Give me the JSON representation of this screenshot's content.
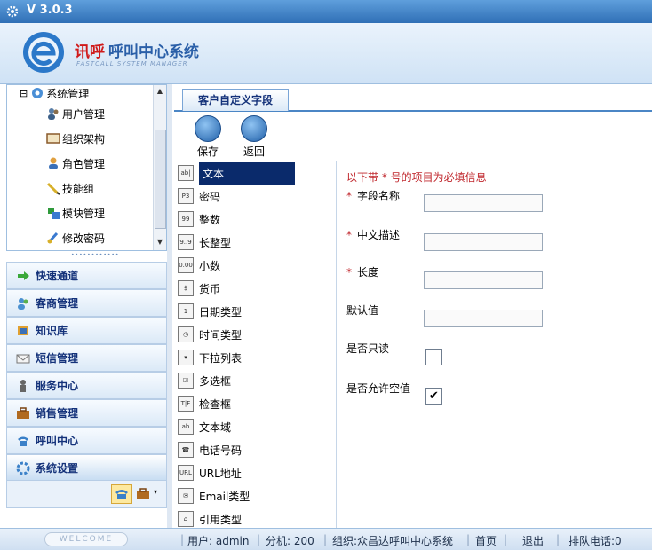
{
  "window": {
    "version": "V 3.0.3"
  },
  "header": {
    "brand": "讯呼",
    "system_name": "呼叫中心系统",
    "subtitle": "FASTCALL SYSTEM MANAGER"
  },
  "tree": {
    "root_label": "系统管理",
    "collapse_symbol": "⊟",
    "items": [
      {
        "label": "用户管理",
        "icon": "users-icon"
      },
      {
        "label": "组织架构",
        "icon": "org-icon"
      },
      {
        "label": "角色管理",
        "icon": "role-icon"
      },
      {
        "label": "技能组",
        "icon": "pencil-icon"
      },
      {
        "label": "模块管理",
        "icon": "module-icon"
      },
      {
        "label": "修改密码",
        "icon": "password-icon"
      }
    ]
  },
  "accordion": [
    {
      "label": "快速通道",
      "icon": "arrow-right-icon"
    },
    {
      "label": "客商管理",
      "icon": "customer-icon"
    },
    {
      "label": "知识库",
      "icon": "book-icon"
    },
    {
      "label": "短信管理",
      "icon": "mail-icon"
    },
    {
      "label": "服务中心",
      "icon": "service-icon"
    },
    {
      "label": "销售管理",
      "icon": "briefcase-icon"
    },
    {
      "label": "呼叫中心",
      "icon": "phone-icon"
    },
    {
      "label": "系统设置",
      "icon": "settings-icon"
    }
  ],
  "main": {
    "tab_label": "客户自定义字段",
    "toolbar": {
      "save_label": "保存",
      "back_label": "返回"
    },
    "field_types": [
      {
        "label": "文本",
        "icon_text": "ab|"
      },
      {
        "label": "密码",
        "icon_text": "P3"
      },
      {
        "label": "整数",
        "icon_text": "99"
      },
      {
        "label": "长整型",
        "icon_text": "9..9"
      },
      {
        "label": "小数",
        "icon_text": "0.00"
      },
      {
        "label": "货币",
        "icon_text": "$"
      },
      {
        "label": "日期类型",
        "icon_text": "1"
      },
      {
        "label": "时间类型",
        "icon_text": "◷"
      },
      {
        "label": "下拉列表",
        "icon_text": "▾"
      },
      {
        "label": "多选框",
        "icon_text": "☑"
      },
      {
        "label": "检查框",
        "icon_text": "T|F"
      },
      {
        "label": "文本域",
        "icon_text": "ab"
      },
      {
        "label": "电话号码",
        "icon_text": "☎"
      },
      {
        "label": "URL地址",
        "icon_text": "URL"
      },
      {
        "label": "Email类型",
        "icon_text": "✉"
      },
      {
        "label": "引用类型",
        "icon_text": "⌂"
      }
    ],
    "form": {
      "required_note": "以下带 * 号的项目为必填信息",
      "required_mark": "*",
      "field_name_label": "字段名称",
      "field_name_value": "",
      "cn_desc_label": "中文描述",
      "cn_desc_value": "",
      "length_label": "长度",
      "length_value": "",
      "default_label": "默认值",
      "default_value": "",
      "readonly_label": "是否只读",
      "readonly_checked": false,
      "allow_null_label": "是否允许空值",
      "allow_null_checked": true,
      "check_mark": "✔"
    }
  },
  "status": {
    "welcome": "WELCOME",
    "user": "用户: admin",
    "ext": "分机: 200",
    "org": "组织:众昌达呼叫中心系统",
    "home": "首页",
    "logout": "退出",
    "queue": "排队电话:0"
  }
}
